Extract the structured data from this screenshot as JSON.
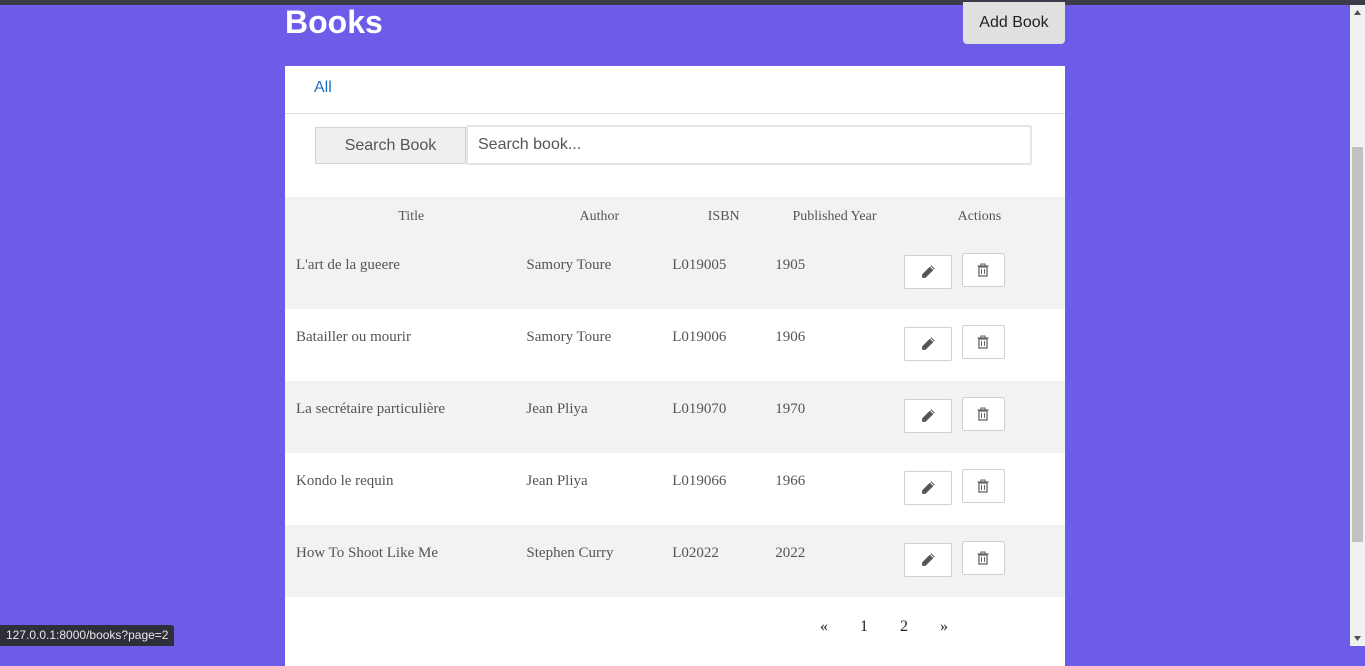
{
  "page": {
    "title": "Books",
    "add_button_label": "Add Book"
  },
  "tabs": [
    {
      "label": "All"
    }
  ],
  "search": {
    "button_label": "Search Book",
    "placeholder": "Search book..."
  },
  "table": {
    "headers": [
      "Title",
      "Author",
      "ISBN",
      "Published Year",
      "Actions"
    ],
    "rows": [
      {
        "title": "L'art de la gueere",
        "author": "Samory Toure",
        "isbn": "L019005",
        "year": "1905"
      },
      {
        "title": "Batailler ou mourir",
        "author": "Samory Toure",
        "isbn": "L019006",
        "year": "1906"
      },
      {
        "title": "La secrétaire particulière",
        "author": "Jean Pliya",
        "isbn": "L019070",
        "year": "1970"
      },
      {
        "title": "Kondo le requin",
        "author": "Jean Pliya",
        "isbn": "L019066",
        "year": "1966"
      },
      {
        "title": "How To Shoot Like Me",
        "author": "Stephen Curry",
        "isbn": "L02022",
        "year": "2022"
      }
    ]
  },
  "pagination": {
    "prev": "«",
    "pages": [
      "1",
      "2"
    ],
    "next": "»"
  },
  "status_bar": {
    "url": "127.0.0.1:8000/books?page=2"
  },
  "colors": {
    "background": "#6c5ce7",
    "link": "#1a6fc2"
  }
}
